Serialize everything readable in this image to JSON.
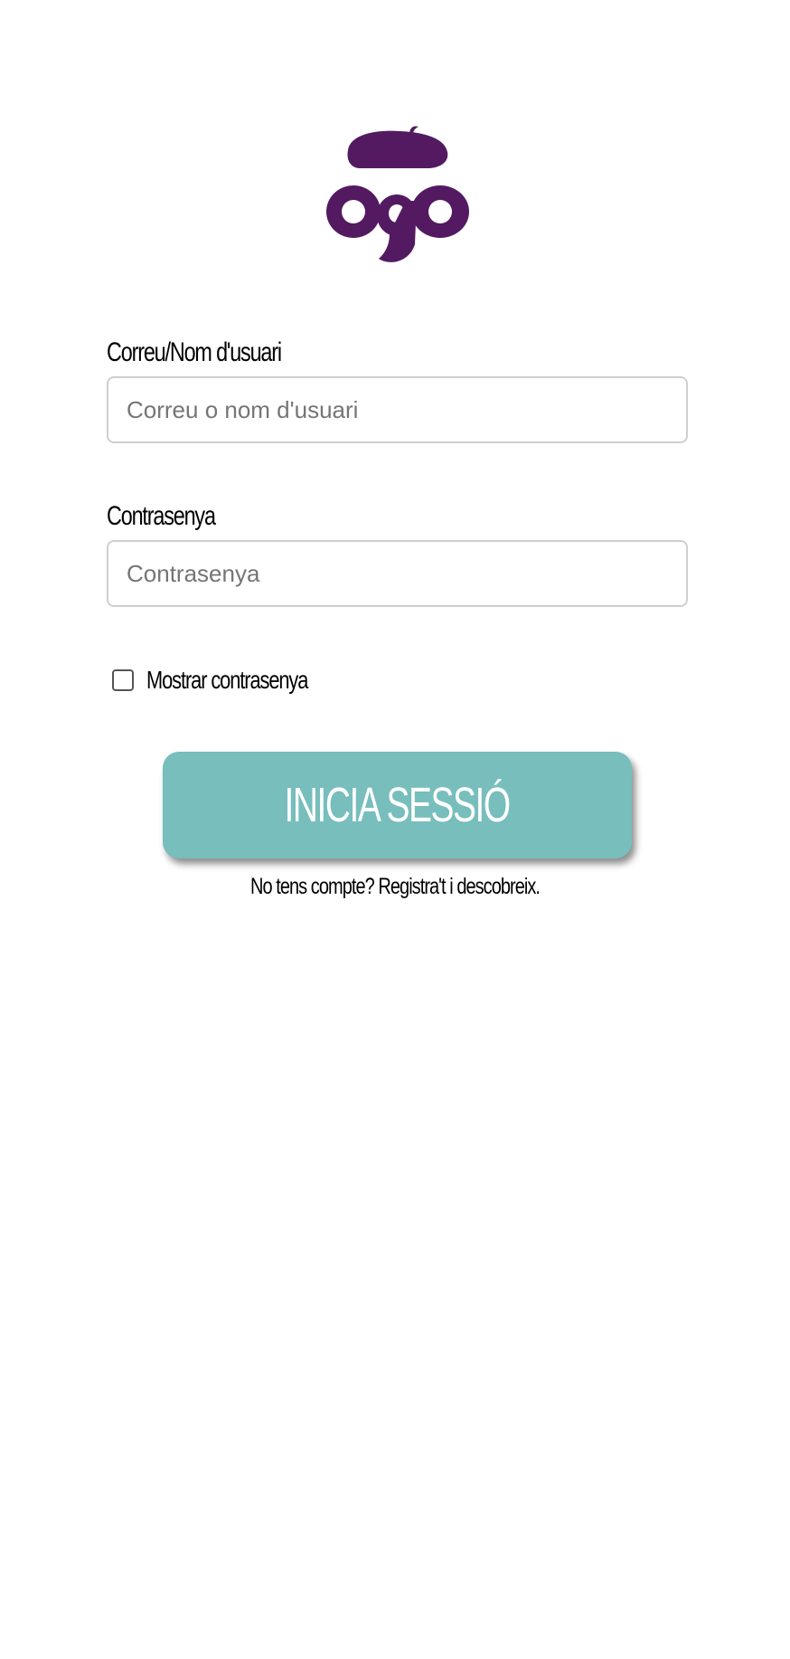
{
  "brand": {
    "logo_text": "ogo",
    "logo_color": "#531a61",
    "logo_icon": "beret-logo-icon"
  },
  "form": {
    "username_label": "Correu/Nom d'usuari",
    "username_placeholder": "Correu o nom d'usuari",
    "username_value": "",
    "password_label": "Contrasenya",
    "password_placeholder": "Contrasenya",
    "password_value": "",
    "show_password_label": "Mostrar contrasenya",
    "show_password_checked": false
  },
  "actions": {
    "login_label": "INICIA SESSIÓ",
    "login_color": "#77bebd",
    "register_text": "No tens compte? Registra't i descobreix."
  }
}
